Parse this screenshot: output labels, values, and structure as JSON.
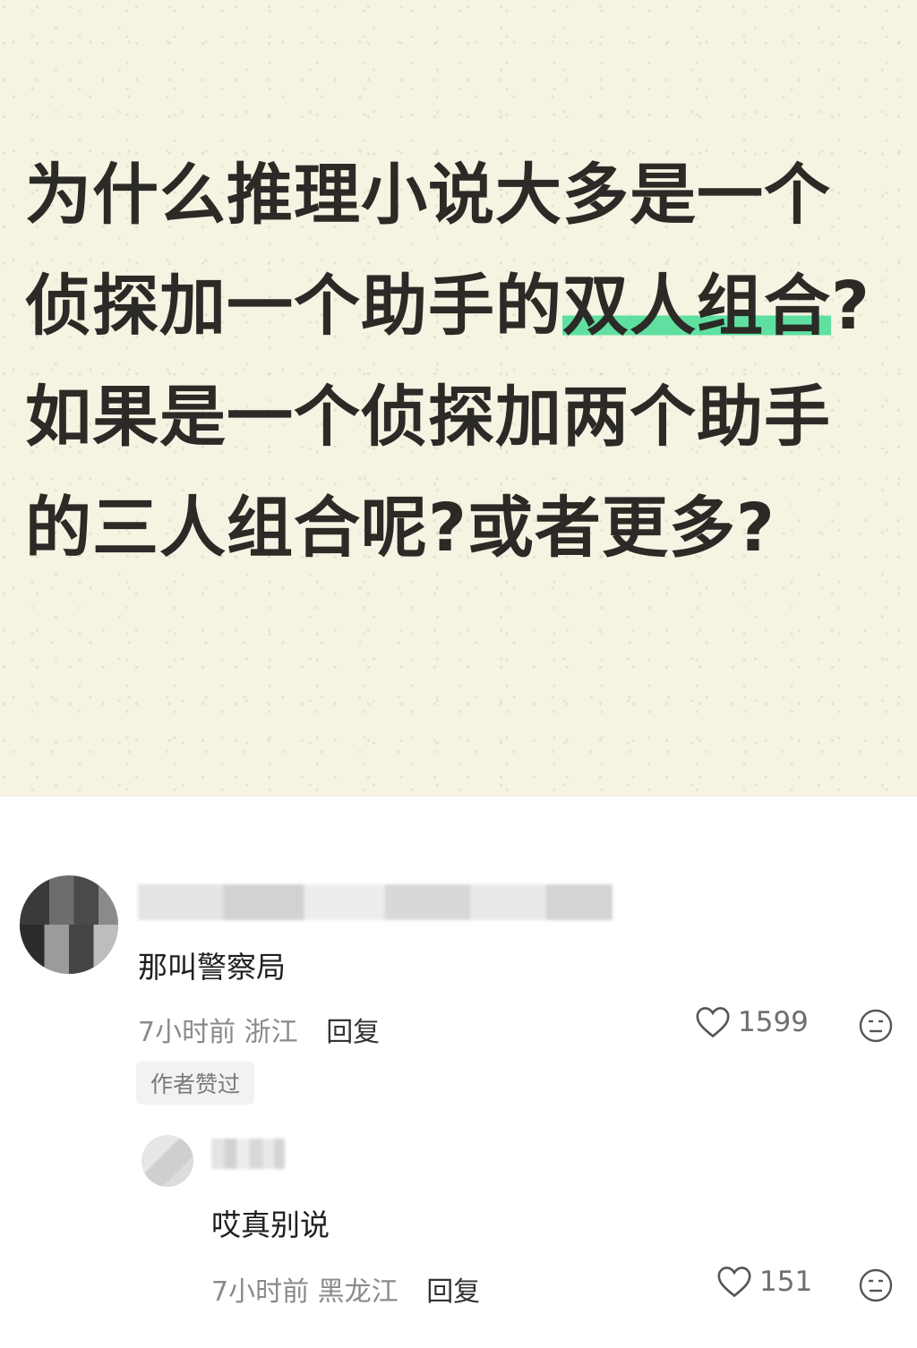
{
  "post": {
    "title_lines": [
      "为什么推理小说大多是一个",
      "侦探加一个助手的",
      "双人组合",
      "?",
      "如果是一个侦探加两个助手",
      "的三人组合呢?或者更多?"
    ],
    "highlight_color": "#5fe0a0",
    "background_color": "#f6f3e3"
  },
  "comments": [
    {
      "text": "那叫警察局",
      "time": "7小时前",
      "location": "浙江",
      "reply_label": "回复",
      "likes": "1599",
      "badge": "作者赞过"
    },
    {
      "text": "哎真别说",
      "time": "7小时前",
      "location": "黑龙江",
      "reply_label": "回复",
      "likes": "151"
    }
  ],
  "icons": {
    "like": "heart-outline-icon",
    "dislike": "neutral-face-icon"
  }
}
